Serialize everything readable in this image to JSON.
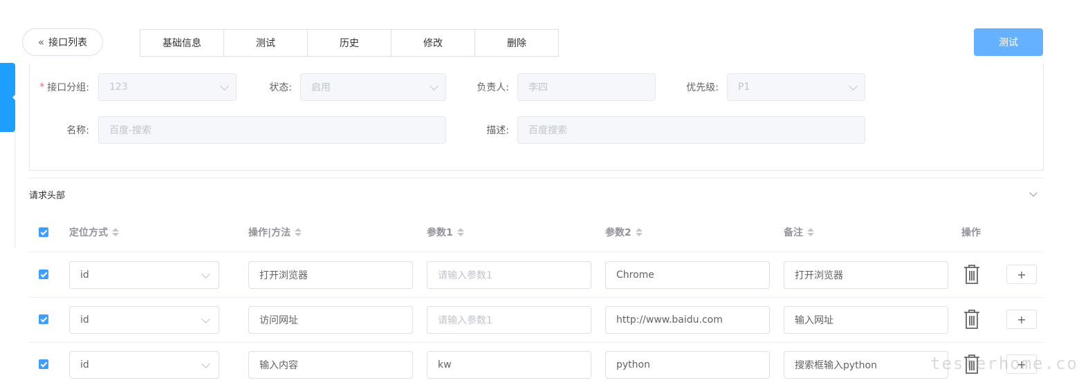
{
  "header": {
    "back_label": "接口列表",
    "tabs": [
      {
        "label": "基础信息"
      },
      {
        "label": "测试"
      },
      {
        "label": "历史"
      },
      {
        "label": "修改"
      },
      {
        "label": "删除"
      }
    ],
    "test_button": "测试"
  },
  "form": {
    "group": {
      "label": "接口分组:",
      "value": "123"
    },
    "status": {
      "label": "状态:",
      "value": "启用"
    },
    "owner": {
      "label": "负责人:",
      "value": "李四"
    },
    "priority": {
      "label": "优先级:",
      "value": "P1"
    },
    "name": {
      "label": "名称:",
      "value": "百度-搜索"
    },
    "desc": {
      "label": "描述:",
      "value": "百度搜索"
    }
  },
  "section": {
    "title": "请求头部"
  },
  "table": {
    "headers": {
      "locate": "定位方式",
      "method": "操作|方法",
      "param1": "参数1",
      "param2": "参数2",
      "note": "备注",
      "ops": "操作"
    },
    "rows": [
      {
        "locate": "id",
        "method": "打开浏览器",
        "param1": "",
        "param1_placeholder": "请输入参数1",
        "param2": "Chrome",
        "note": "打开浏览器"
      },
      {
        "locate": "id",
        "method": "访问网址",
        "param1": "",
        "param1_placeholder": "请输入参数1",
        "param2": "http://www.baidu.com",
        "note": "输入网址"
      },
      {
        "locate": "id",
        "method": "输入内容",
        "param1": "kw",
        "param1_placeholder": "请输入参数1",
        "param2": "python",
        "note": "搜索框输入python"
      }
    ],
    "plus_label": "+"
  },
  "watermark": "testerhome.com",
  "colors": {
    "primary": "#409eff",
    "test_button": "#66b1ff",
    "side_tab": "#1e9fff",
    "required": "#f56c6c"
  }
}
